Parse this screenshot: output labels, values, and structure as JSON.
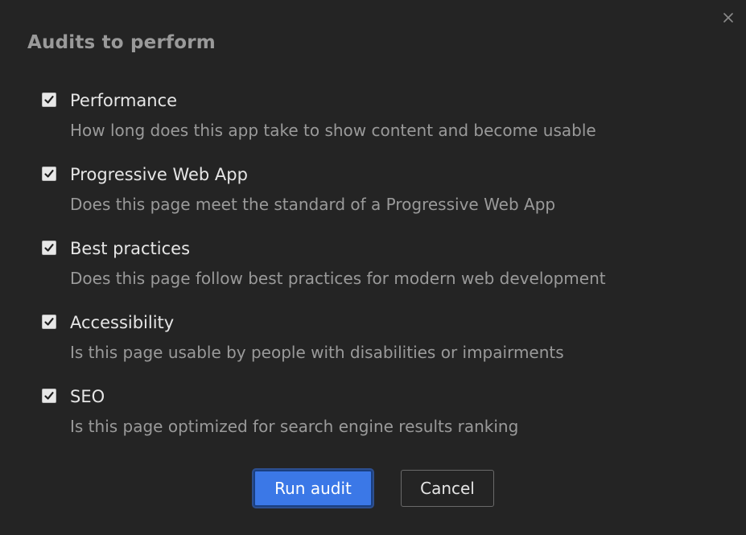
{
  "dialog": {
    "title": "Audits to perform",
    "close_icon": "close-icon"
  },
  "audits": [
    {
      "label": "Performance",
      "description": "How long does this app take to show content and become usable",
      "checked": true
    },
    {
      "label": "Progressive Web App",
      "description": "Does this page meet the standard of a Progressive Web App",
      "checked": true
    },
    {
      "label": "Best practices",
      "description": "Does this page follow best practices for modern web development",
      "checked": true
    },
    {
      "label": "Accessibility",
      "description": "Is this page usable by people with disabilities or impairments",
      "checked": true
    },
    {
      "label": "SEO",
      "description": "Is this page optimized for search engine results ranking",
      "checked": true
    }
  ],
  "buttons": {
    "run_label": "Run audit",
    "cancel_label": "Cancel"
  },
  "colors": {
    "background": "#242424",
    "primary": "#3b78e7",
    "title": "#9a9a9a",
    "label": "#e6e6e6",
    "description": "#9a9a9a"
  }
}
